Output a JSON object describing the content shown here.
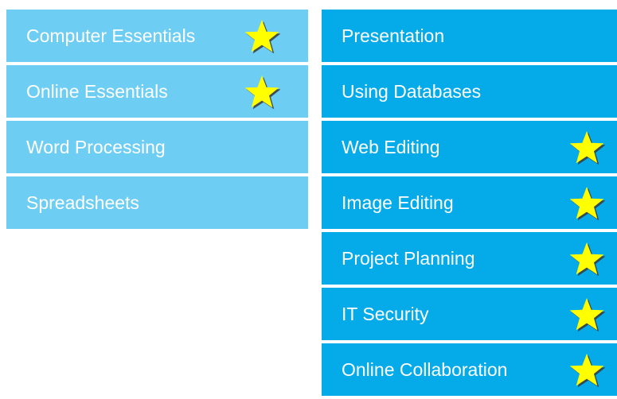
{
  "left_column": {
    "items": [
      {
        "label": "Computer Essentials",
        "starred": true
      },
      {
        "label": "Online Essentials",
        "starred": true
      },
      {
        "label": "Word Processing",
        "starred": false
      },
      {
        "label": "Spreadsheets",
        "starred": false
      }
    ]
  },
  "right_column": {
    "items": [
      {
        "label": "Presentation",
        "starred": false
      },
      {
        "label": "Using Databases",
        "starred": false
      },
      {
        "label": "Web Editing",
        "starred": true
      },
      {
        "label": "Image Editing",
        "starred": true
      },
      {
        "label": "Project Planning",
        "starred": true
      },
      {
        "label": "IT Security",
        "starred": true
      },
      {
        "label": "Online Collaboration",
        "starred": true
      }
    ]
  },
  "colors": {
    "left_tile": "#6dcdf3",
    "right_tile": "#05aae9",
    "star_fill": "#ffff00",
    "star_shadow": "#3a3a3a",
    "text": "#ffffff"
  },
  "icons": {
    "star": "star-icon"
  }
}
